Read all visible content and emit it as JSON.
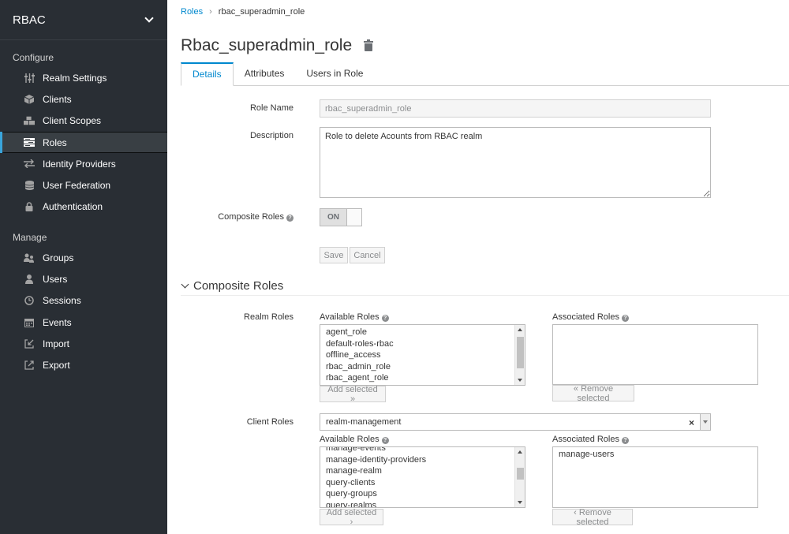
{
  "sidebar": {
    "realm": "RBAC",
    "configure_title": "Configure",
    "manage_title": "Manage",
    "configure_items": [
      {
        "label": "Realm Settings",
        "icon": "sliders-icon"
      },
      {
        "label": "Clients",
        "icon": "cube-icon"
      },
      {
        "label": "Client Scopes",
        "icon": "cubes-icon"
      },
      {
        "label": "Roles",
        "icon": "list-icon"
      },
      {
        "label": "Identity Providers",
        "icon": "exchange-icon"
      },
      {
        "label": "User Federation",
        "icon": "database-icon"
      },
      {
        "label": "Authentication",
        "icon": "lock-icon"
      }
    ],
    "manage_items": [
      {
        "label": "Groups",
        "icon": "users-icon"
      },
      {
        "label": "Users",
        "icon": "user-icon"
      },
      {
        "label": "Sessions",
        "icon": "clock-icon"
      },
      {
        "label": "Events",
        "icon": "calendar-icon"
      },
      {
        "label": "Import",
        "icon": "import-icon"
      },
      {
        "label": "Export",
        "icon": "export-icon"
      }
    ]
  },
  "breadcrumb": {
    "parent": "Roles",
    "current": "rbac_superadmin_role"
  },
  "page_title": "Rbac_superadmin_role",
  "tabs": [
    "Details",
    "Attributes",
    "Users in Role"
  ],
  "form": {
    "role_name_label": "Role Name",
    "role_name_value": "rbac_superadmin_role",
    "description_label": "Description",
    "description_value": "Role to delete Acounts from RBAC realm",
    "composite_label": "Composite Roles",
    "composite_state": "ON",
    "save": "Save",
    "cancel": "Cancel"
  },
  "composite": {
    "title": "Composite Roles",
    "realm_roles_label": "Realm Roles",
    "client_roles_label": "Client Roles",
    "available_label": "Available Roles",
    "associated_label": "Associated Roles",
    "add_selected": "Add selected »",
    "add_selected_client": "Add selected ›",
    "remove_selected": "« Remove selected",
    "remove_selected_client": "‹ Remove selected",
    "realm_available": [
      "agent_role",
      "default-roles-rbac",
      "offline_access",
      "rbac_admin_role",
      "rbac_agent_role"
    ],
    "realm_associated": [],
    "client_selected": "realm-management",
    "client_available": [
      "manage-events",
      "manage-identity-providers",
      "manage-realm",
      "query-clients",
      "query-groups",
      "query-realms"
    ],
    "client_associated": [
      "manage-users"
    ]
  }
}
